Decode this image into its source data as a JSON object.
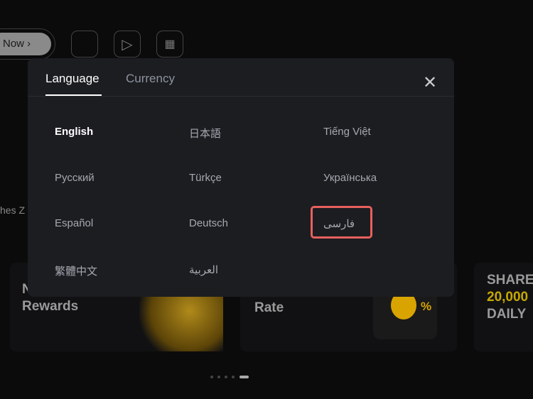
{
  "background": {
    "download_button": "Now ›",
    "store_icons": [
      "apple-icon",
      "google-play-icon",
      "qr-code-icon"
    ],
    "partial_text": "hes Z",
    "cards": [
      {
        "line1": "N",
        "line2": "Rewards"
      },
      {
        "line2": "Rate"
      },
      {
        "badge": "%"
      },
      {
        "line1": "SHARE",
        "line2": "20,000",
        "line3": "DAILY"
      }
    ],
    "pagination": {
      "count": 5,
      "active": 5
    }
  },
  "modal": {
    "tabs": [
      {
        "label": "Language",
        "active": true
      },
      {
        "label": "Currency",
        "active": false
      }
    ],
    "close_icon": "close-icon",
    "languages": [
      {
        "label": "English",
        "selected": true
      },
      {
        "label": "日本語"
      },
      {
        "label": "Tiếng Việt"
      },
      {
        "label": "Русский"
      },
      {
        "label": "Türkçe"
      },
      {
        "label": "Українська"
      },
      {
        "label": "Español"
      },
      {
        "label": "Deutsch"
      },
      {
        "label": "فارسی",
        "highlighted": true
      },
      {
        "label": "繁體中文"
      },
      {
        "label": "العربية"
      }
    ],
    "highlight_color": "#e8605d"
  }
}
